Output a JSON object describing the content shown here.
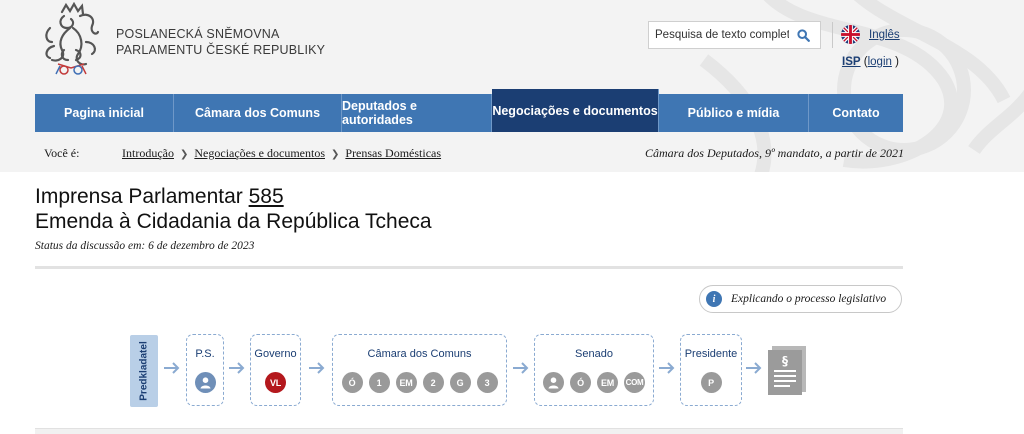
{
  "header": {
    "brand_line1": "POSLANECKÁ SNĚMOVNA",
    "brand_line2": "PARLAMENTU ČESKÉ REPUBLIKY",
    "search_placeholder": "Pesquisa de texto completo",
    "language_label": "Inglês",
    "isp_label": "ISP",
    "login_open": "(",
    "login_label": "login",
    "login_close": ")"
  },
  "nav": {
    "items": [
      {
        "label": "Pagina inicial"
      },
      {
        "label": "Câmara dos Comuns"
      },
      {
        "label": "Deputados e autoridades"
      },
      {
        "label": "Negociações e documentos"
      },
      {
        "label": "Público e mídia"
      },
      {
        "label": "Contato"
      }
    ],
    "active_index": 3
  },
  "breadcrumb": {
    "prefix": "Você é:",
    "items": [
      "Introdução",
      "Negociações e documentos",
      "Prensas Domésticas"
    ],
    "term": "Câmara dos Deputados, 9º mandato, a partir de 2021"
  },
  "page": {
    "title_prefix": "Imprensa Parlamentar",
    "print_number": "585",
    "subtitle": "Emenda à Cidadania da República Tcheca",
    "status": "Status da discussão em: 6 de dezembro de 2023",
    "explain_icon": "i",
    "explain_label": "Explicando o processo legislativo"
  },
  "process": {
    "proposer_label": "Predkladatel",
    "stages": [
      {
        "label": "P.S.",
        "steps": [
          {
            "text": "",
            "kind": "person"
          }
        ]
      },
      {
        "label": "Governo",
        "steps": [
          {
            "text": "VL",
            "kind": "red"
          }
        ]
      },
      {
        "label": "Câmara dos Comuns",
        "steps": [
          {
            "text": "Ó"
          },
          {
            "text": "1"
          },
          {
            "text": "EM"
          },
          {
            "text": "2"
          },
          {
            "text": "G"
          },
          {
            "text": "3"
          }
        ]
      },
      {
        "label": "Senado",
        "steps": [
          {
            "text": "",
            "kind": "person-gray"
          },
          {
            "text": "Ó"
          },
          {
            "text": "EM"
          },
          {
            "text": "COM"
          }
        ]
      },
      {
        "label": "Presidente",
        "steps": [
          {
            "text": "P"
          }
        ]
      }
    ]
  },
  "colors": {
    "nav": "#3f76b3",
    "nav_active": "#1b3e73",
    "stage_border": "#8aaad1",
    "step_gray": "#9a9a9a",
    "step_red": "#b4181d"
  }
}
